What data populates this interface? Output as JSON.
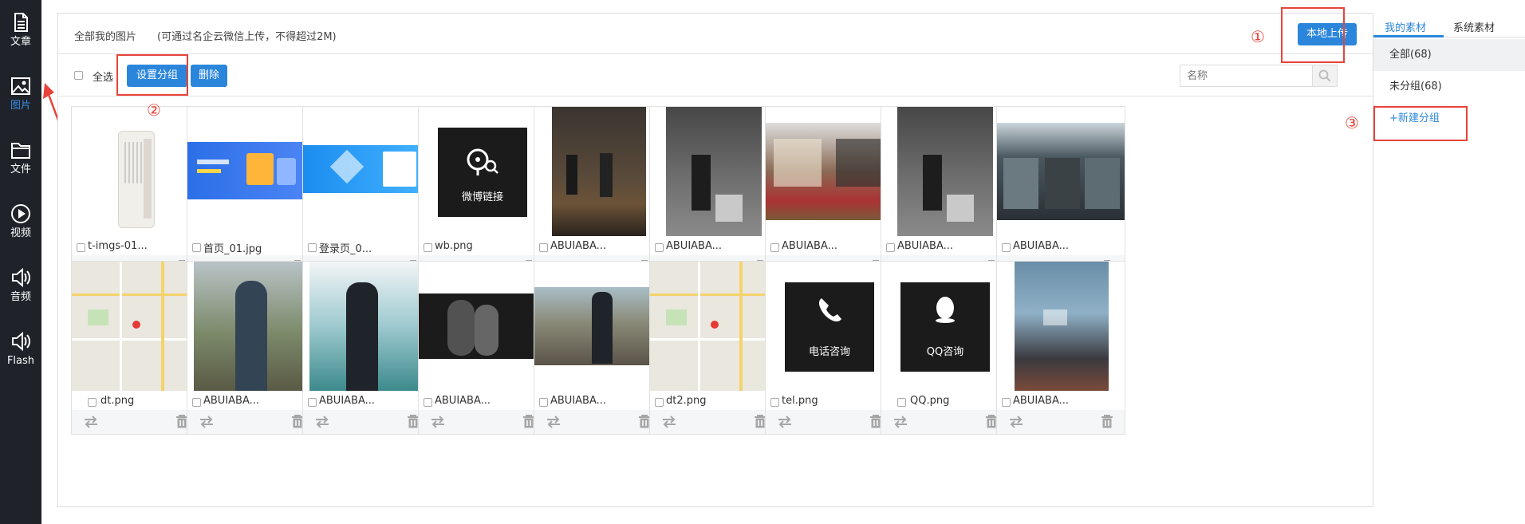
{
  "sidebar": {
    "items": [
      {
        "label": "文章",
        "icon": "document-icon",
        "active": false
      },
      {
        "label": "图片",
        "icon": "image-icon",
        "active": true
      },
      {
        "label": "文件",
        "icon": "folder-icon",
        "active": false
      },
      {
        "label": "视频",
        "icon": "play-icon",
        "active": false
      },
      {
        "label": "音频",
        "icon": "speaker-icon",
        "active": false
      },
      {
        "label": "Flash",
        "icon": "speaker-icon",
        "active": false
      }
    ],
    "accent": "#3a8ee6"
  },
  "header": {
    "title": "全部我的图片",
    "hint": "(可通过名企云微信上传，不得超过2M)",
    "upload_button": "本地上传"
  },
  "toolbar": {
    "select_all": "全选",
    "set_group_button": "设置分组",
    "delete_button": "删除",
    "search_placeholder": "名称"
  },
  "images": [
    {
      "name": "t-imgs-01...",
      "kind": "purifier"
    },
    {
      "name": "首页_01.jpg",
      "kind": "banner-blue"
    },
    {
      "name": "登录页_0...",
      "kind": "banner-login"
    },
    {
      "name": "wb.png",
      "kind": "icon-weibo",
      "caption": "微博链接"
    },
    {
      "name": "ABUIABA...",
      "kind": "shop-dark"
    },
    {
      "name": "ABUIABA...",
      "kind": "shop-gray"
    },
    {
      "name": "ABUIABA...",
      "kind": "shop-front"
    },
    {
      "name": "ABUIABA...",
      "kind": "shop-gray"
    },
    {
      "name": "ABUIABA...",
      "kind": "shop-store"
    },
    {
      "name": "dt.png",
      "kind": "map"
    },
    {
      "name": "ABUIABA...",
      "kind": "portrait-coast"
    },
    {
      "name": "ABUIABA...",
      "kind": "portrait-sea"
    },
    {
      "name": "ABUIABA...",
      "kind": "portrait-dark"
    },
    {
      "name": "ABUIABA...",
      "kind": "portrait-rocks"
    },
    {
      "name": "dt2.png",
      "kind": "map"
    },
    {
      "name": "tel.png",
      "kind": "icon-phone",
      "caption": "电话咨询"
    },
    {
      "name": "QQ.png",
      "kind": "icon-qq",
      "caption": "QQ咨询"
    },
    {
      "name": "ABUIABA...",
      "kind": "shop-blur"
    }
  ],
  "right_panel": {
    "tabs": [
      "我的素材",
      "系统素材"
    ],
    "groups": [
      {
        "label": "全部(68)",
        "selected": true
      },
      {
        "label": "未分组(68)",
        "selected": false
      }
    ],
    "new_group": "+新建分组"
  },
  "annotations": {
    "mark1": "①",
    "mark2": "②",
    "mark3": "③",
    "color": "#e8433a"
  }
}
